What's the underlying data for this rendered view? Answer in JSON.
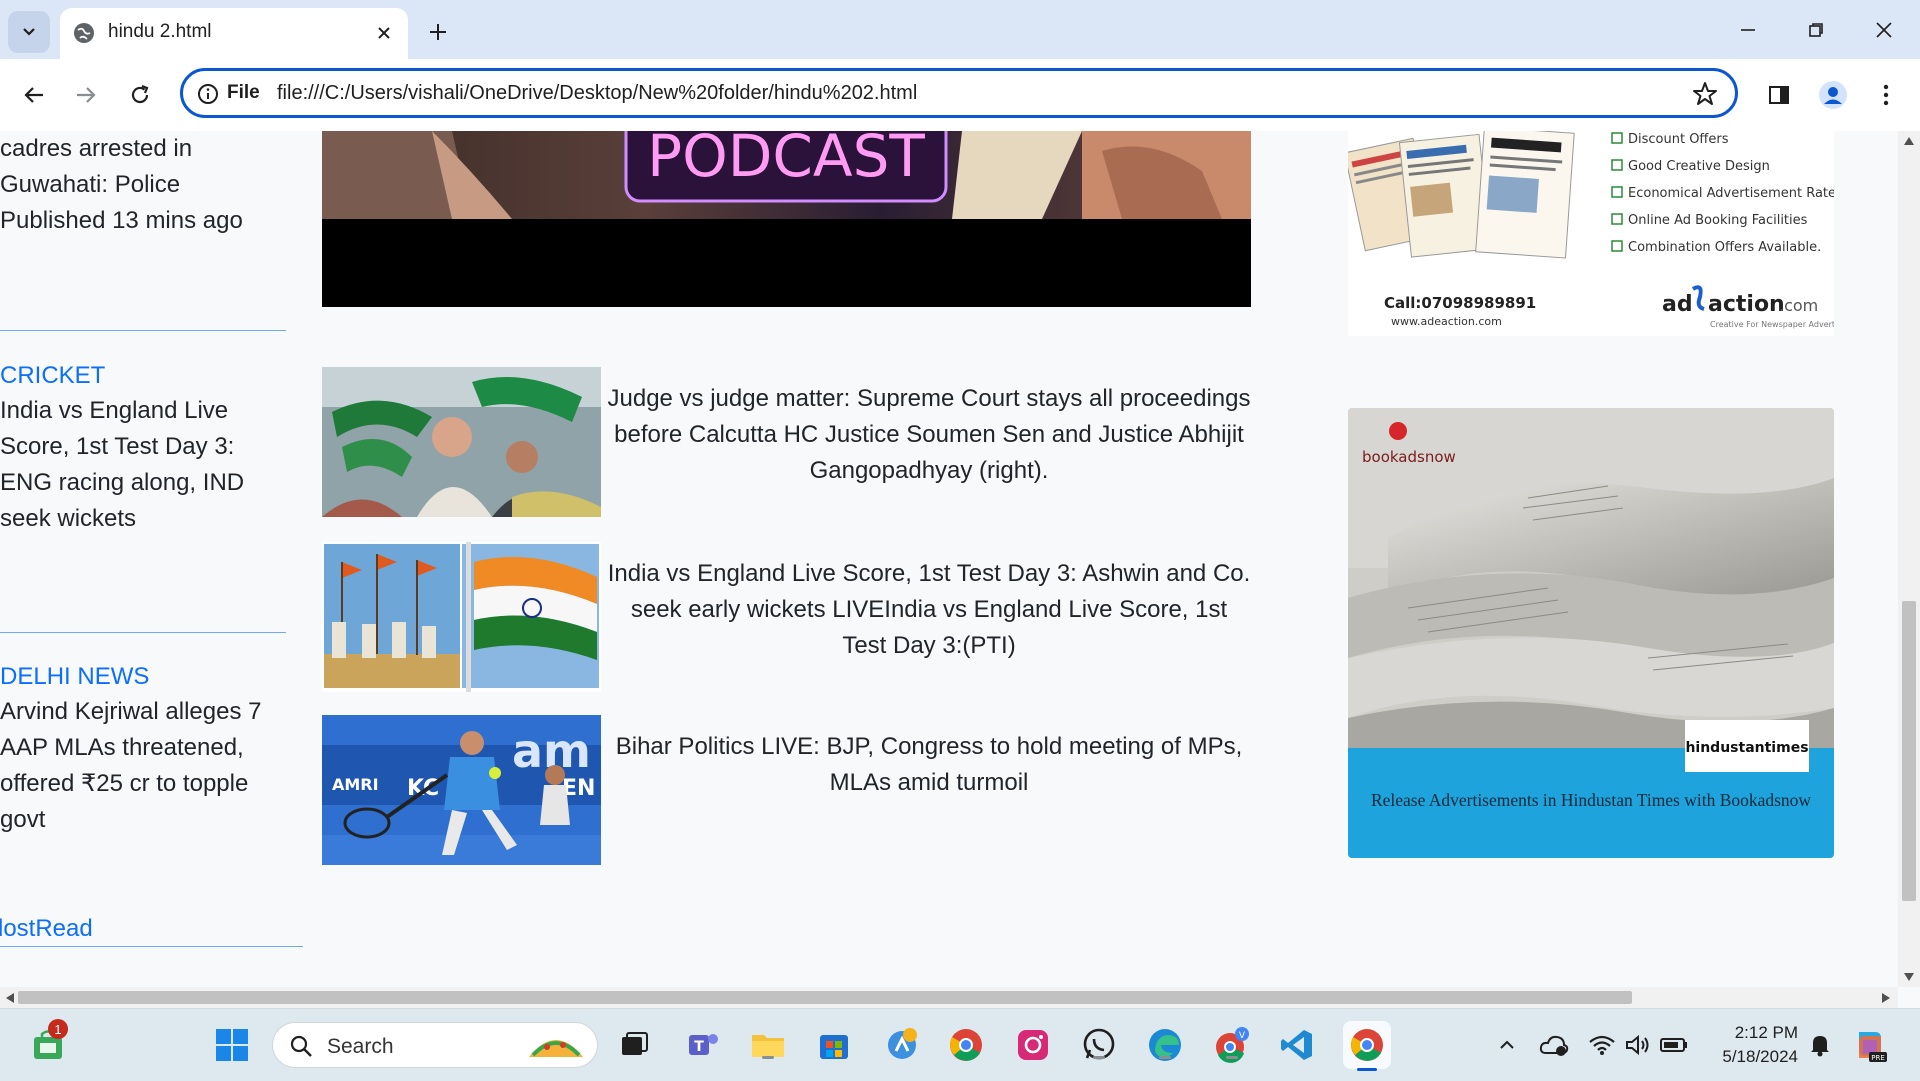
{
  "browser": {
    "tab_title": "hindu 2.html",
    "site_chip": "File",
    "url": "file:///C:/Users/vishali/OneDrive/Desktop/New%20folder/hindu%202.html"
  },
  "left_column": {
    "top_snippet": "cadres arrested in Guwahati: Police Published 13 mins ago",
    "sections": [
      {
        "category": "CRICKET",
        "headline": "India vs England Live Score, 1st Test Day 3: ENG racing along, IND seek wickets"
      },
      {
        "category": "DELHI NEWS",
        "headline": "Arvind Kejriwal alleges 7 AAP MLAs threatened, offered ₹25 cr to topple govt"
      }
    ],
    "most_read": "lostRead"
  },
  "hero": {
    "label": "PODCAST"
  },
  "stories": [
    {
      "text": "Judge vs judge matter: Supreme Court stays all proceedings before Calcutta HC Justice Soumen Sen and Justice Abhijit Gangopadhyay (right)."
    },
    {
      "text": "India vs England Live Score, 1st Test Day 3: Ashwin and Co. seek early wickets LIVEIndia vs England Live Score, 1st Test Day 3:(PTI)"
    },
    {
      "text": "Bihar Politics LIVE: BJP, Congress to hold meeting of MPs, MLAs amid turmoil"
    }
  ],
  "ad_top": {
    "bullets": [
      "Discount Offers",
      "Good Creative Design",
      "Economical Advertisement Rates",
      "Online Ad Booking Facilities",
      "Combination Offers Available."
    ],
    "phone": "Call:07098989891",
    "site": "www.adeaction.com",
    "brand_a": "ad",
    "brand_b": "action",
    "brand_c": ".com",
    "tagline": "Creative For Newspaper Advertising"
  },
  "ad_bottom": {
    "brand": "bookadsnow",
    "paper": "hindustantimes",
    "caption": "Release Advertisements in Hindustan Times with Bookadsnow"
  },
  "taskbar": {
    "search_label": "Search",
    "time": "2:12 PM",
    "date": "5/18/2024",
    "store_badge": "1"
  },
  "colors": {
    "link": "#0d6efd",
    "omnibox_border": "#0b57d0",
    "tab_strip": "#dbe6f6"
  }
}
